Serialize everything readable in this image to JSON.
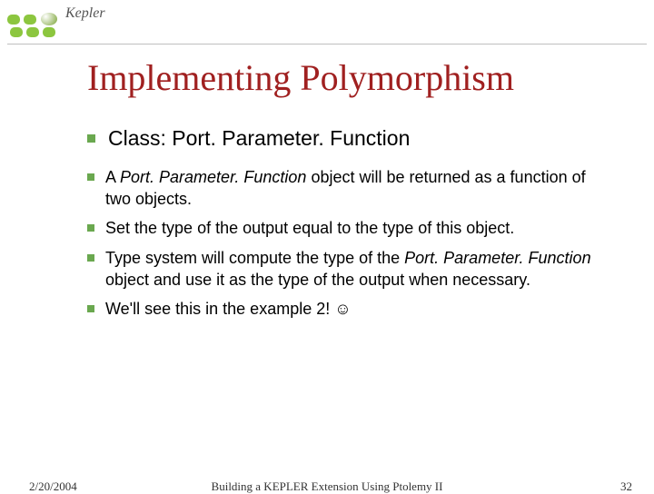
{
  "brand": "Kepler",
  "title": "Implementing Polymorphism",
  "main_bullet": {
    "text": "Class: Port. Parameter. Function"
  },
  "sub_bullets": [
    {
      "parts": [
        {
          "t": "A ",
          "italic": false
        },
        {
          "t": "Port. Parameter. Function",
          "italic": true
        },
        {
          "t": " object will be returned as a function of two objects.",
          "italic": false
        }
      ]
    },
    {
      "parts": [
        {
          "t": "Set the type of the output equal to the type of this object.",
          "italic": false
        }
      ]
    },
    {
      "parts": [
        {
          "t": "Type system will compute the type of the ",
          "italic": false
        },
        {
          "t": "Port. Parameter. Function",
          "italic": true
        },
        {
          "t": " object and use it as the type of the output when necessary.",
          "italic": false
        }
      ]
    },
    {
      "parts": [
        {
          "t": "We'll see this in the example 2! ☺",
          "italic": false
        }
      ]
    }
  ],
  "footer": {
    "date": "2/20/2004",
    "mid": "Building a KEPLER Extension Using Ptolemy II",
    "page": "32"
  }
}
